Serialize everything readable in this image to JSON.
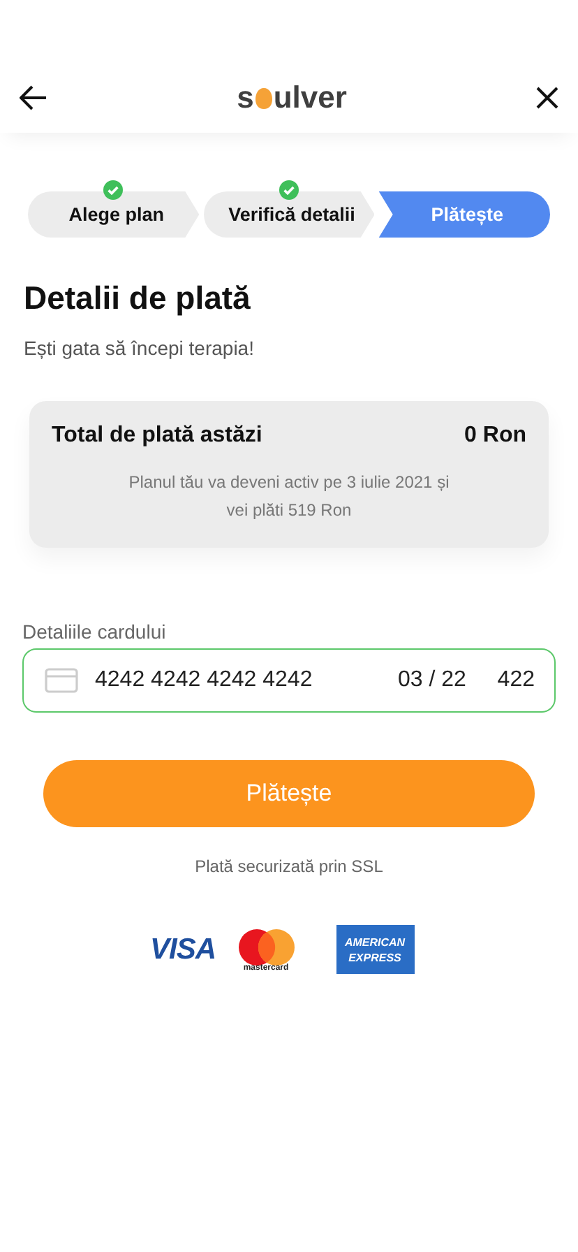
{
  "header": {
    "logo_start": "s",
    "logo_end": "ulver"
  },
  "steps": [
    {
      "label": "Alege plan",
      "done": true,
      "selected": false
    },
    {
      "label": "Verifică detalii",
      "done": true,
      "selected": false
    },
    {
      "label": "Plătește",
      "done": false,
      "selected": true
    }
  ],
  "title": "Detalii de plată",
  "subtitle": "Ești gata să începi terapia!",
  "summary": {
    "label": "Total de plată astăzi",
    "amount": "0 Ron",
    "note": "Planul tău va deveni activ pe 3 iulie 2021 și vei plăti 519 Ron"
  },
  "card_field": {
    "label": "Detaliile cardului",
    "number": "4242 4242 4242 4242",
    "expiry": "03 / 22",
    "cvc": "422",
    "valid": true
  },
  "pay_button": "Plătește",
  "secure_note": "Plată securizată prin SSL",
  "payment_logos": [
    {
      "kind": "visa",
      "text": "VISA"
    },
    {
      "kind": "mastercard",
      "text": "mastercard"
    },
    {
      "kind": "amex",
      "text": "AMERICAN EXPRESS"
    }
  ]
}
